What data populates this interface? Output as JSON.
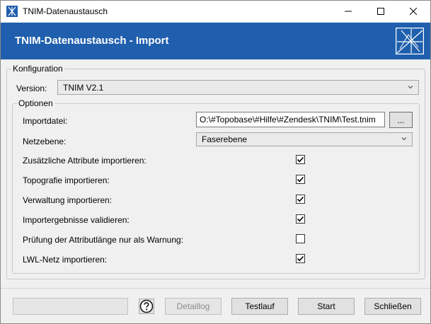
{
  "window": {
    "title": "TNIM-Datenaustausch"
  },
  "header": {
    "title": "TNIM-Datenaustausch - Import"
  },
  "konfiguration": {
    "legend": "Konfiguration",
    "version_label": "Version:",
    "version_value": "TNIM V2.1"
  },
  "optionen": {
    "legend": "Optionen",
    "importdatei_label": "Importdatei:",
    "importdatei_value": "O:\\#Topobase\\#Hilfe\\#Zendesk\\TNIM\\Test.tnim",
    "browse_label": "...",
    "netzebene_label": "Netzebene:",
    "netzebene_value": "Faserebene",
    "checks": [
      {
        "label": "Zusätzliche Attribute importieren:",
        "checked": true
      },
      {
        "label": "Topografie importieren:",
        "checked": true
      },
      {
        "label": "Verwaltung importieren:",
        "checked": true
      },
      {
        "label": "Importergebnisse validieren:",
        "checked": true
      },
      {
        "label": "Prüfung der Attributlänge nur als Warnung:",
        "checked": false
      },
      {
        "label": "LWL-Netz importieren:",
        "checked": true
      }
    ]
  },
  "footer": {
    "help_icon": "question-circle-icon",
    "detaillog_label": "Detaillog",
    "testlauf_label": "Testlauf",
    "start_label": "Start",
    "schliessen_label": "Schließen"
  },
  "colors": {
    "header_bg": "#1f5fad",
    "header_text": "#ffffff"
  }
}
